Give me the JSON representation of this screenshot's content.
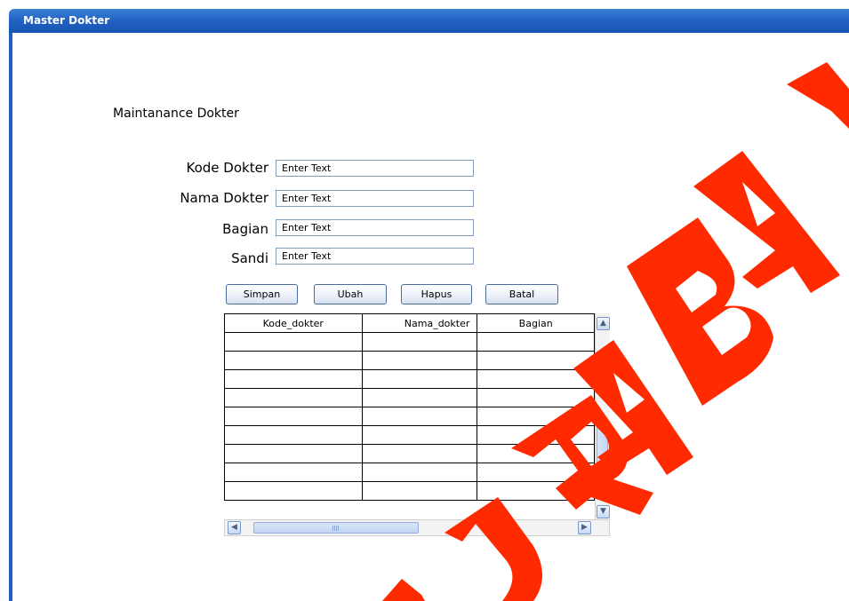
{
  "window": {
    "title": "Master Dokter"
  },
  "form": {
    "heading": "Maintanance Dokter",
    "fields": [
      {
        "label": "Kode Dokter",
        "value": "Enter Text"
      },
      {
        "label": "Nama Dokter",
        "value": "Enter Text"
      },
      {
        "label": "Bagian",
        "value": "Enter Text"
      },
      {
        "label": "Sandi",
        "value": "Enter Text"
      }
    ]
  },
  "buttons": {
    "simpan": "Simpan",
    "ubah": "Ubah",
    "hapus": "Hapus",
    "batal": "Batal"
  },
  "table": {
    "columns": [
      "Kode_dokter",
      "Nama_dokter",
      "Bagian"
    ],
    "empty_rows": 9
  },
  "scrollbars": {
    "up_icon": "chevron-up-icon",
    "down_icon": "chevron-down-icon",
    "left_icon": "chevron-left-icon",
    "right_icon": "chevron-right-icon"
  },
  "watermark": {
    "color": "#ff2a00"
  },
  "colors": {
    "titlebar": "#1f5fc0",
    "title_text": "#ffffff",
    "input_border": "#7f9db9"
  }
}
